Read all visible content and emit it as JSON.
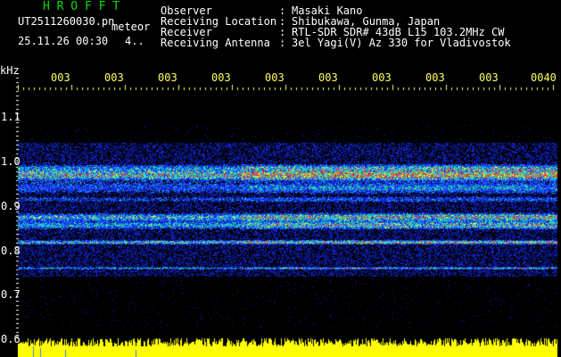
{
  "header": {
    "title": "H R O F F T",
    "filename": "UT2511260030.pn",
    "mode": "meteor",
    "timestamp": "25.11.26 00:30",
    "flag": "4..",
    "info": [
      {
        "label": "Observer",
        "value": "Masaki Kano"
      },
      {
        "label": "Receiving Location",
        "value": "Shibukawa, Gunma, Japan"
      },
      {
        "label": "Receiver",
        "value": "RTL-SDR SDR# 43dB L15 103.2MHz CW"
      },
      {
        "label": "Receiving Antenna",
        "value": "3el Yagi(V) Az 330 for Vladivostok"
      }
    ]
  },
  "axis": {
    "unit": "kHz",
    "y_ticks": [
      "1.1",
      "1.0",
      "0.9",
      "0.8",
      "0.7",
      "0.6"
    ],
    "x_ticks": [
      "003",
      "003",
      "003",
      "003",
      "003",
      "003",
      "003",
      "003",
      "003",
      "0040"
    ]
  },
  "colors": {
    "background": "#000000",
    "title_green": "#00e000",
    "time_label": "#ffff60",
    "amplitude_trace": "#ffff00",
    "noise_blue": "#1a2cff"
  }
}
